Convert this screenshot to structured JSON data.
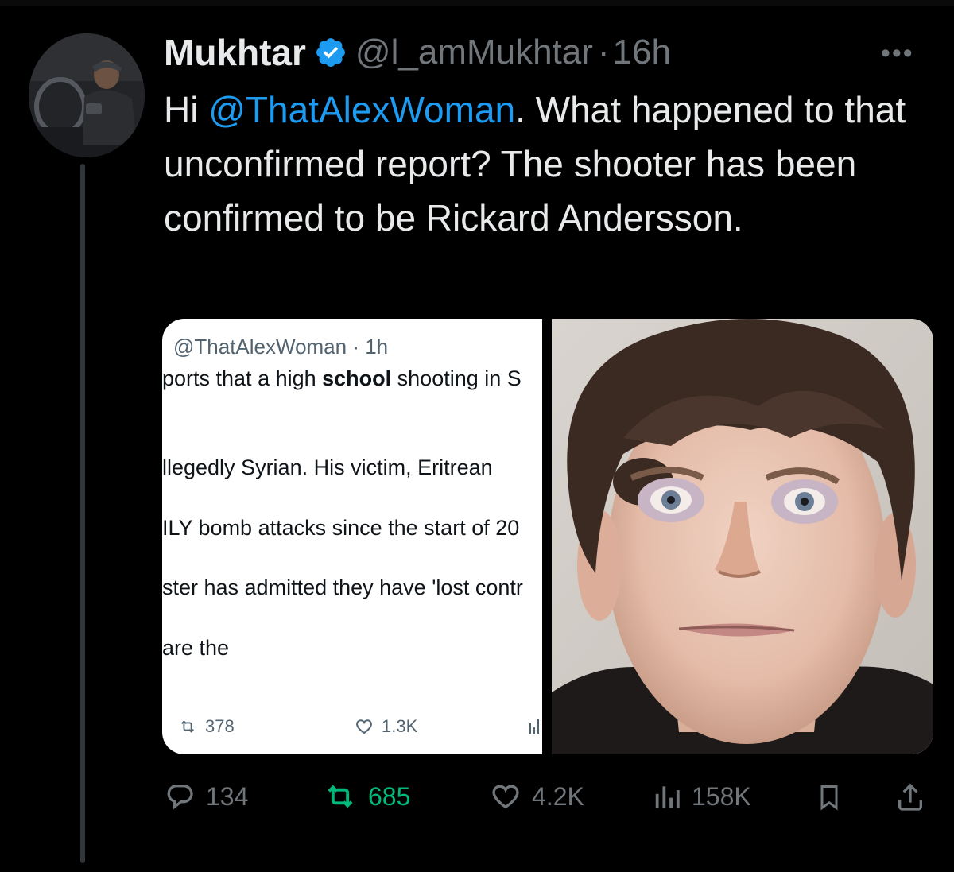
{
  "tweet": {
    "author_name": "Mukhtar",
    "author_handle": "@l_amMukhtar",
    "separator": "·",
    "time": "16h",
    "more_label": "•••",
    "text_parts": {
      "before": "Hi ",
      "mention": "@ThatAlexWoman",
      "after": ". What happened to that unconfirmed report? The shooter has been confirmed to be Rickard Andersson."
    },
    "icons": {
      "verified": "verified-badge-icon",
      "reply": "reply-icon",
      "retweet": "retweet-icon",
      "like": "heart-icon",
      "views": "views-icon",
      "bookmark": "bookmark-icon",
      "share": "share-icon"
    },
    "colors": {
      "mention": "#1d9bf0",
      "retweeted": "#00ba7c",
      "verified": "#1d9bf0"
    }
  },
  "embedded": {
    "meta": "@ThatAlexWoman · 1h",
    "line1_pre": "ports that a high ",
    "line1_bold": "school",
    "line1_post": " shooting in S",
    "line2": "llegedly Syrian. His victim, Eritrean",
    "line3": "ILY bomb attacks  since the start of 20",
    "line4": "ster has admitted they have 'lost contr",
    "line5": "are the",
    "retweets": "378",
    "likes": "1.3K"
  },
  "actions": {
    "replies": "134",
    "retweets": "685",
    "likes": "4.2K",
    "views": "158K"
  }
}
